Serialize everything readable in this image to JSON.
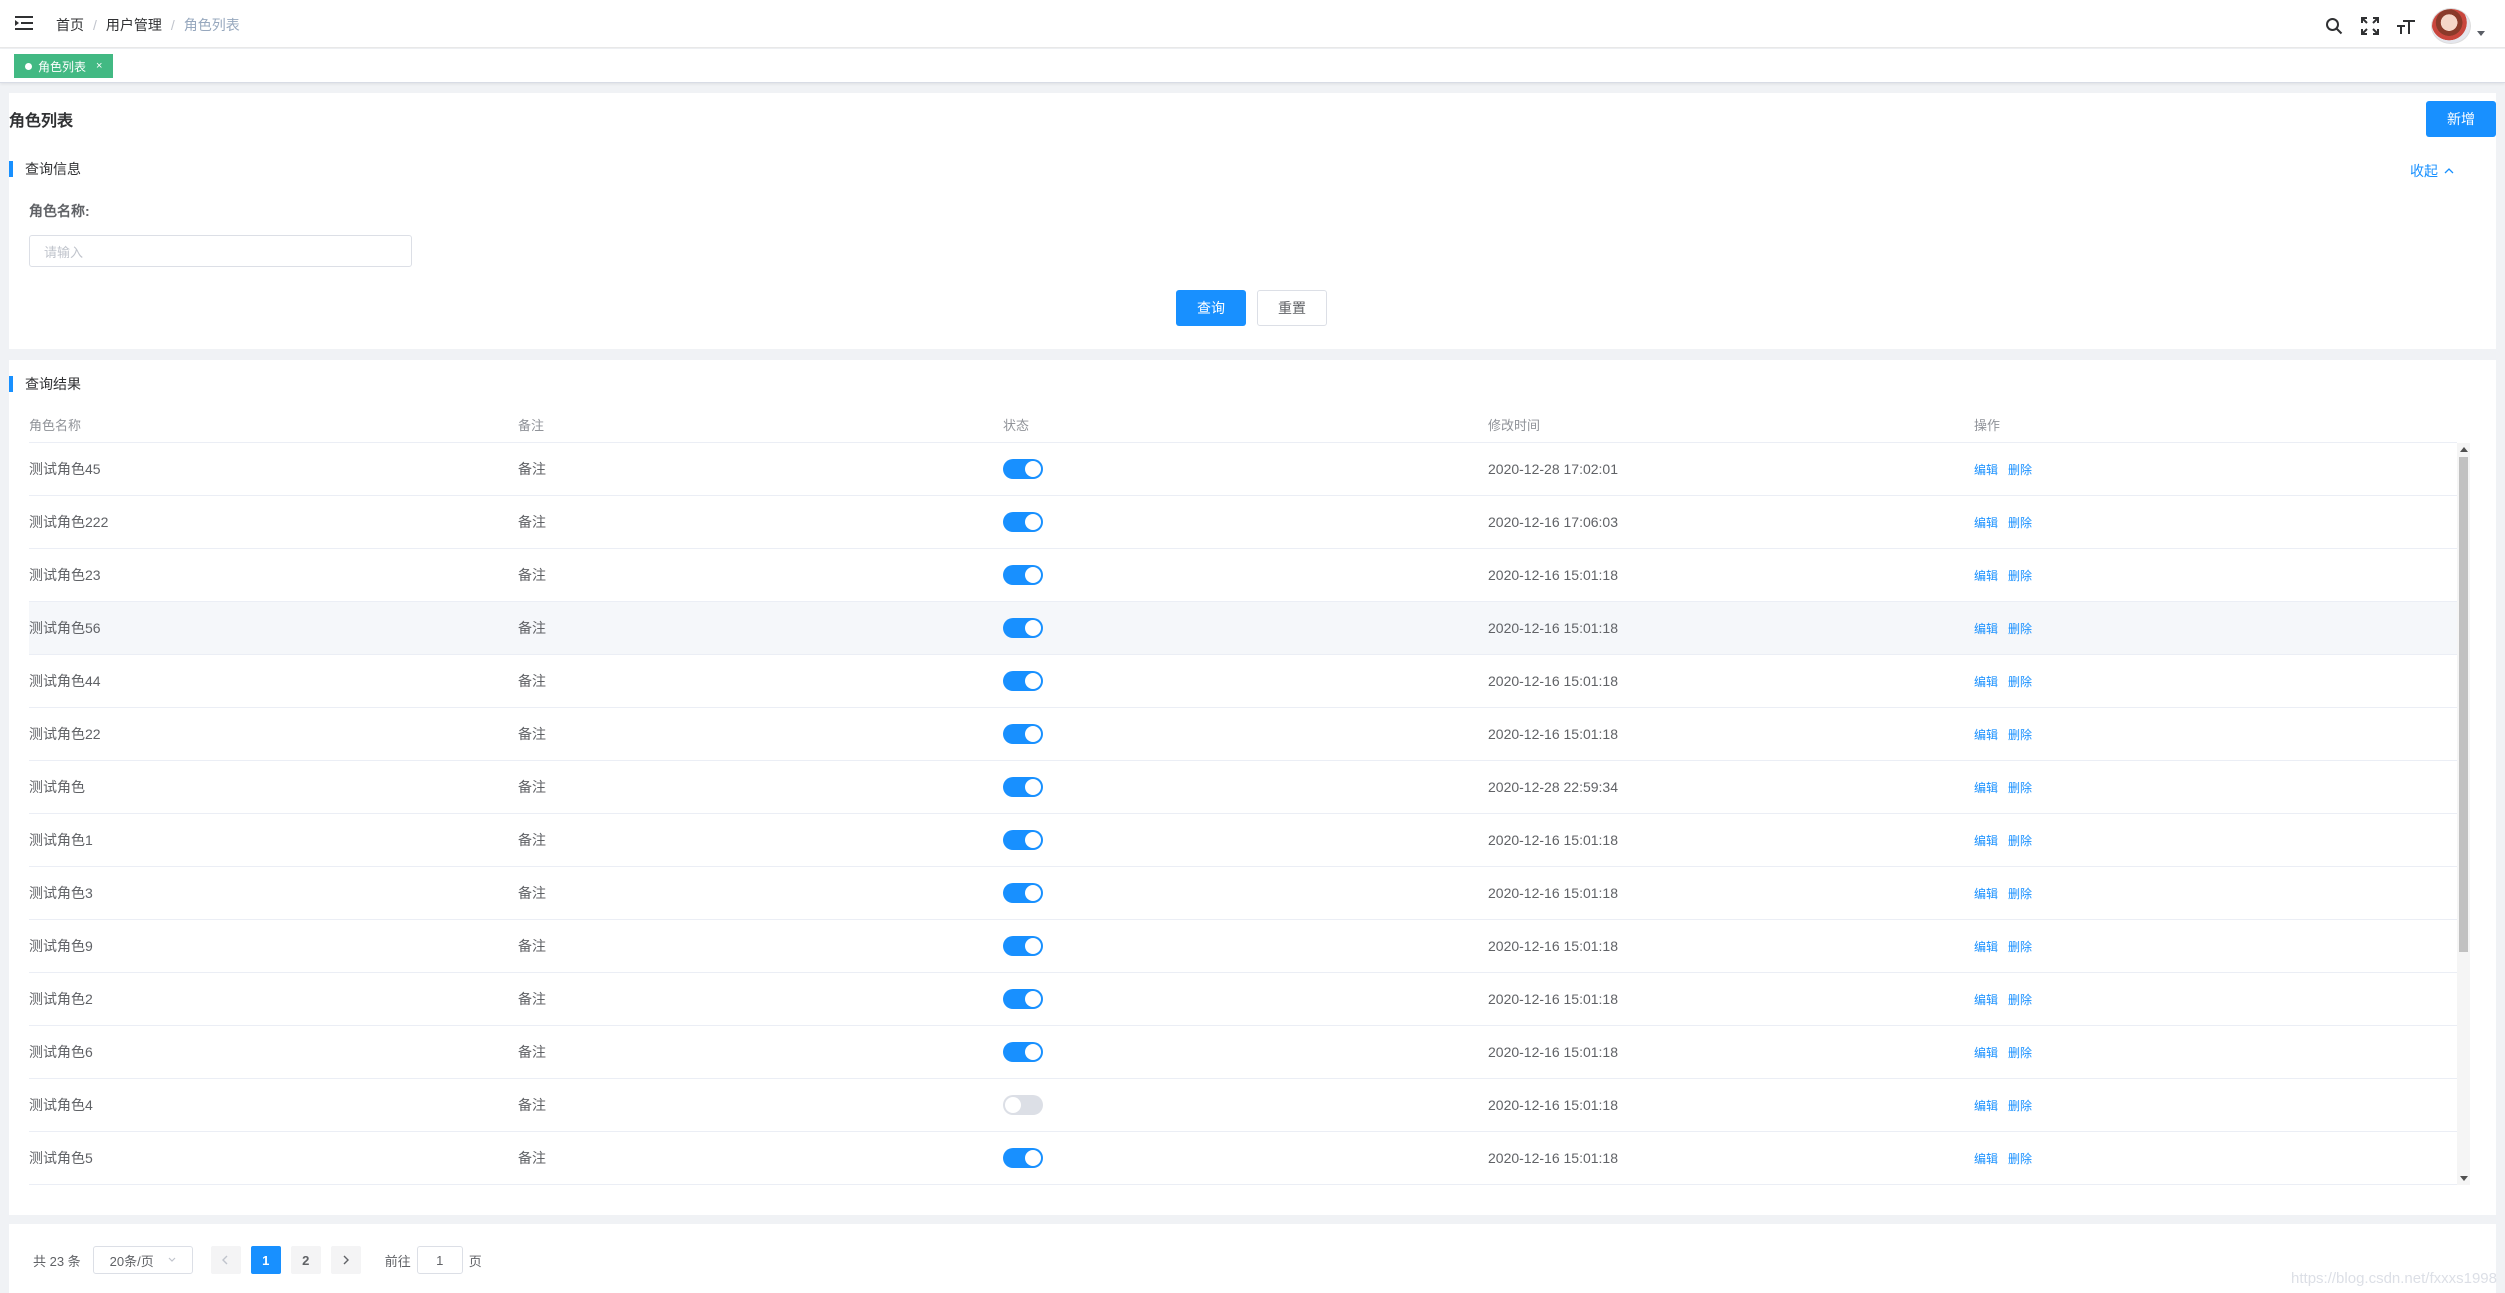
{
  "navbar": {
    "breadcrumb": [
      "首页",
      "用户管理",
      "角色列表"
    ],
    "separator": "/"
  },
  "tags": [
    {
      "label": "角色列表",
      "close": "×",
      "active_color": "#42b983"
    }
  ],
  "page": {
    "title": "角色列表",
    "add_label": "新增",
    "query_section": "查询信息",
    "collapse_label": "收起",
    "field_label": "角色名称:",
    "input_placeholder": "请输入",
    "query_label": "查询",
    "reset_label": "重置",
    "result_section": "查询结果",
    "accent": "#1890ff"
  },
  "table": {
    "headers": [
      "角色名称",
      "备注",
      "状态",
      "修改时间",
      "操作"
    ],
    "edit_label": "编辑",
    "delete_label": "删除",
    "rows": [
      {
        "name": "测试角色45",
        "remark": "备注",
        "enabled": true,
        "time": "2020-12-28 17:02:01"
      },
      {
        "name": "测试角色222",
        "remark": "备注",
        "enabled": true,
        "time": "2020-12-16 17:06:03"
      },
      {
        "name": "测试角色23",
        "remark": "备注",
        "enabled": true,
        "time": "2020-12-16 15:01:18"
      },
      {
        "name": "测试角色56",
        "remark": "备注",
        "enabled": true,
        "time": "2020-12-16 15:01:18"
      },
      {
        "name": "测试角色44",
        "remark": "备注",
        "enabled": true,
        "time": "2020-12-16 15:01:18"
      },
      {
        "name": "测试角色22",
        "remark": "备注",
        "enabled": true,
        "time": "2020-12-16 15:01:18"
      },
      {
        "name": "测试角色",
        "remark": "备注",
        "enabled": true,
        "time": "2020-12-28 22:59:34"
      },
      {
        "name": "测试角色1",
        "remark": "备注",
        "enabled": true,
        "time": "2020-12-16 15:01:18"
      },
      {
        "name": "测试角色3",
        "remark": "备注",
        "enabled": true,
        "time": "2020-12-16 15:01:18"
      },
      {
        "name": "测试角色9",
        "remark": "备注",
        "enabled": true,
        "time": "2020-12-16 15:01:18"
      },
      {
        "name": "测试角色2",
        "remark": "备注",
        "enabled": true,
        "time": "2020-12-16 15:01:18"
      },
      {
        "name": "测试角色6",
        "remark": "备注",
        "enabled": true,
        "time": "2020-12-16 15:01:18"
      },
      {
        "name": "测试角色4",
        "remark": "备注",
        "enabled": false,
        "time": "2020-12-16 15:01:18"
      },
      {
        "name": "测试角色5",
        "remark": "备注",
        "enabled": true,
        "time": "2020-12-16 15:01:18"
      }
    ]
  },
  "pager": {
    "total": "共 23 条",
    "page_size": "20条/页",
    "pages": [
      "1",
      "2"
    ],
    "current": "1",
    "goto_label": "前往",
    "goto_value": "1",
    "page_suffix": "页"
  },
  "watermark": "https://blog.csdn.net/fxxxs1998"
}
